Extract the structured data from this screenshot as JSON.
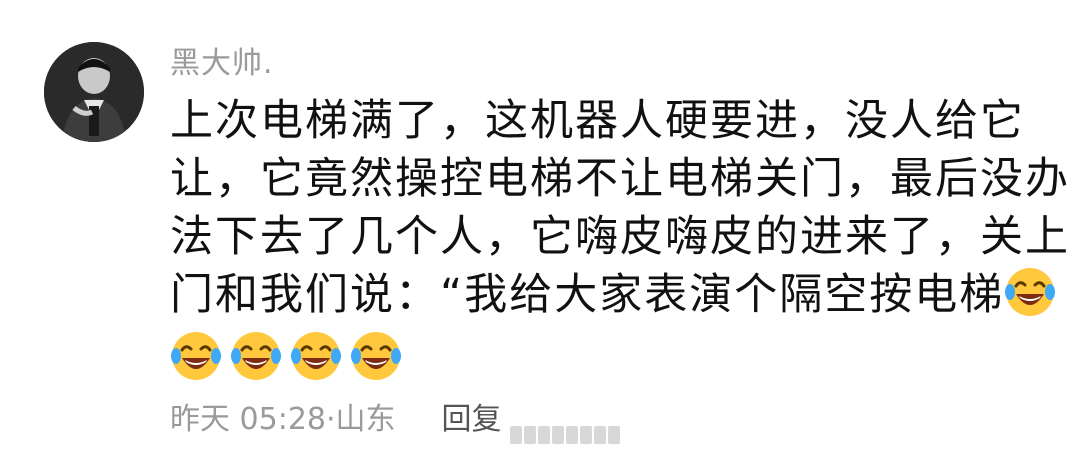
{
  "comment": {
    "username": "黑大帅.",
    "lines": [
      "上次电梯满了，这机器人硬要进，没人给它",
      "让，它竟然操控电梯不让电梯关门，最后没办",
      "法下去了几个人，它嗨皮嗨皮的进来了，关上",
      "门和我们说：“我给大家表演个隔空按电梯"
    ],
    "emoji_name": "laughing-crying-emoji",
    "emoji_count_inline": 1,
    "emoji_count_row": 4,
    "meta": {
      "time": "昨天 05:28",
      "separator": "·",
      "location": "山东",
      "reply_label": "回复"
    }
  }
}
